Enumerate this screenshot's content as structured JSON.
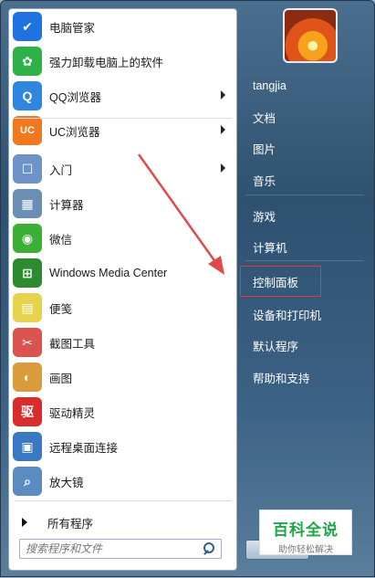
{
  "left_menu": {
    "items": [
      {
        "label": "电脑管家",
        "icon": "shield-icon",
        "color": "#1e73e0",
        "glyph": "✔",
        "submenu": false
      },
      {
        "label": "强力卸载电脑上的软件",
        "icon": "colorful-flower-icon",
        "color": "#2fb14a",
        "glyph": "✿",
        "submenu": false
      },
      {
        "label": "QQ浏览器",
        "icon": "qq-browser-icon",
        "color": "#2e86de",
        "glyph": "Q",
        "submenu": true
      },
      {
        "label": "UC浏览器",
        "icon": "uc-browser-icon",
        "color": "#f0781e",
        "glyph": "UC",
        "submenu": true
      },
      {
        "label": "入门",
        "icon": "getting-started-icon",
        "color": "#6e93c8",
        "glyph": "☐",
        "submenu": true
      },
      {
        "label": "计算器",
        "icon": "calculator-icon",
        "color": "#6a8fb5",
        "glyph": "▦",
        "submenu": false
      },
      {
        "label": "微信",
        "icon": "wechat-icon",
        "color": "#3cb034",
        "glyph": "◉",
        "submenu": false
      },
      {
        "label": "Windows Media Center",
        "icon": "windows-logo-icon",
        "color": "#2c8b2e",
        "glyph": "⊞",
        "submenu": false
      },
      {
        "label": "便笺",
        "icon": "sticky-notes-icon",
        "color": "#e6d34b",
        "glyph": "▤",
        "submenu": false
      },
      {
        "label": "截图工具",
        "icon": "snipping-tool-icon",
        "color": "#d9534f",
        "glyph": "✂",
        "submenu": false
      },
      {
        "label": "画图",
        "icon": "paint-palette-icon",
        "color": "#d99b3b",
        "glyph": "◐",
        "submenu": false
      },
      {
        "label": "驱动精灵",
        "icon": "driver-genius-icon",
        "color": "#d72d2d",
        "glyph": "驱",
        "submenu": false
      },
      {
        "label": "远程桌面连接",
        "icon": "remote-desktop-icon",
        "color": "#3a79c2",
        "glyph": "▣",
        "submenu": false
      },
      {
        "label": "放大镜",
        "icon": "magnifier-icon",
        "color": "#5b8bc0",
        "glyph": "⌕",
        "submenu": false
      }
    ],
    "all_programs": "所有程序",
    "search_placeholder": "搜索程序和文件"
  },
  "right_menu": {
    "items": [
      {
        "label": "tangjia"
      },
      {
        "label": "文档"
      },
      {
        "label": "图片"
      },
      {
        "label": "音乐"
      },
      {
        "label": "游戏"
      },
      {
        "label": "计算机"
      },
      {
        "label": "控制面板"
      },
      {
        "label": "设备和打印机"
      },
      {
        "label": "默认程序"
      },
      {
        "label": "帮助和支持"
      }
    ]
  },
  "watermark": {
    "title": "百科全说",
    "subtitle": "助你轻松解决"
  },
  "colors": {
    "highlight": "#e23a3a",
    "arrow": "#e14a4a",
    "watermark_green": "#20a64a"
  }
}
